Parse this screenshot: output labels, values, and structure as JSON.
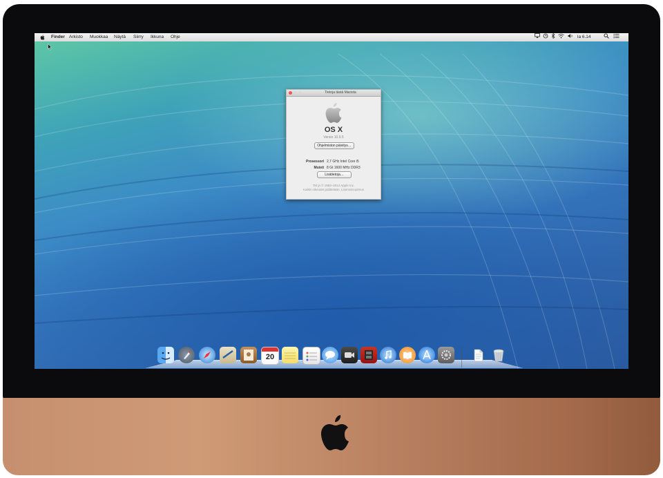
{
  "menubar": {
    "apple": "",
    "items": [
      "Finder",
      "Arkisto",
      "Muokkaa",
      "Näytä",
      "Siirry",
      "Ikkuna",
      "Ohje"
    ],
    "clock": "la 6.14"
  },
  "about_window": {
    "title": "Tietoja tästä Macista",
    "os_name": "OS X",
    "version": "Versio 10.9.5",
    "update_button": "Ohjelmiston päivitys…",
    "processor_label": "Prosessori",
    "processor_value": "2,7 GHz Intel Core i5",
    "memory_label": "Muisti",
    "memory_value": "8 Gt 1600 MHz DDR3",
    "more_button": "Lisätietoja…",
    "copyright_line1": "TM ja © 1983–2014 Apple Inc.",
    "copyright_line2": "Kaikki oikeudet pidätetään. Lisenssisopimus"
  },
  "dock": {
    "items": [
      "finder-icon",
      "launchpad-icon",
      "safari-icon",
      "mail-icon",
      "contacts-icon",
      "calendar-icon",
      "notes-icon",
      "reminders-icon",
      "messages-icon",
      "facetime-icon",
      "photo-booth-icon",
      "itunes-icon",
      "ibooks-icon",
      "app-store-icon",
      "system-preferences-icon",
      "documents-stack-icon",
      "trash-icon"
    ],
    "calendar_day": "20"
  },
  "colors": {
    "wallpaper_top": "#5fc9a4",
    "wallpaper_bottom": "#2a5a9f",
    "bezel": "#0b0b0d",
    "chin": "#c6906f"
  }
}
